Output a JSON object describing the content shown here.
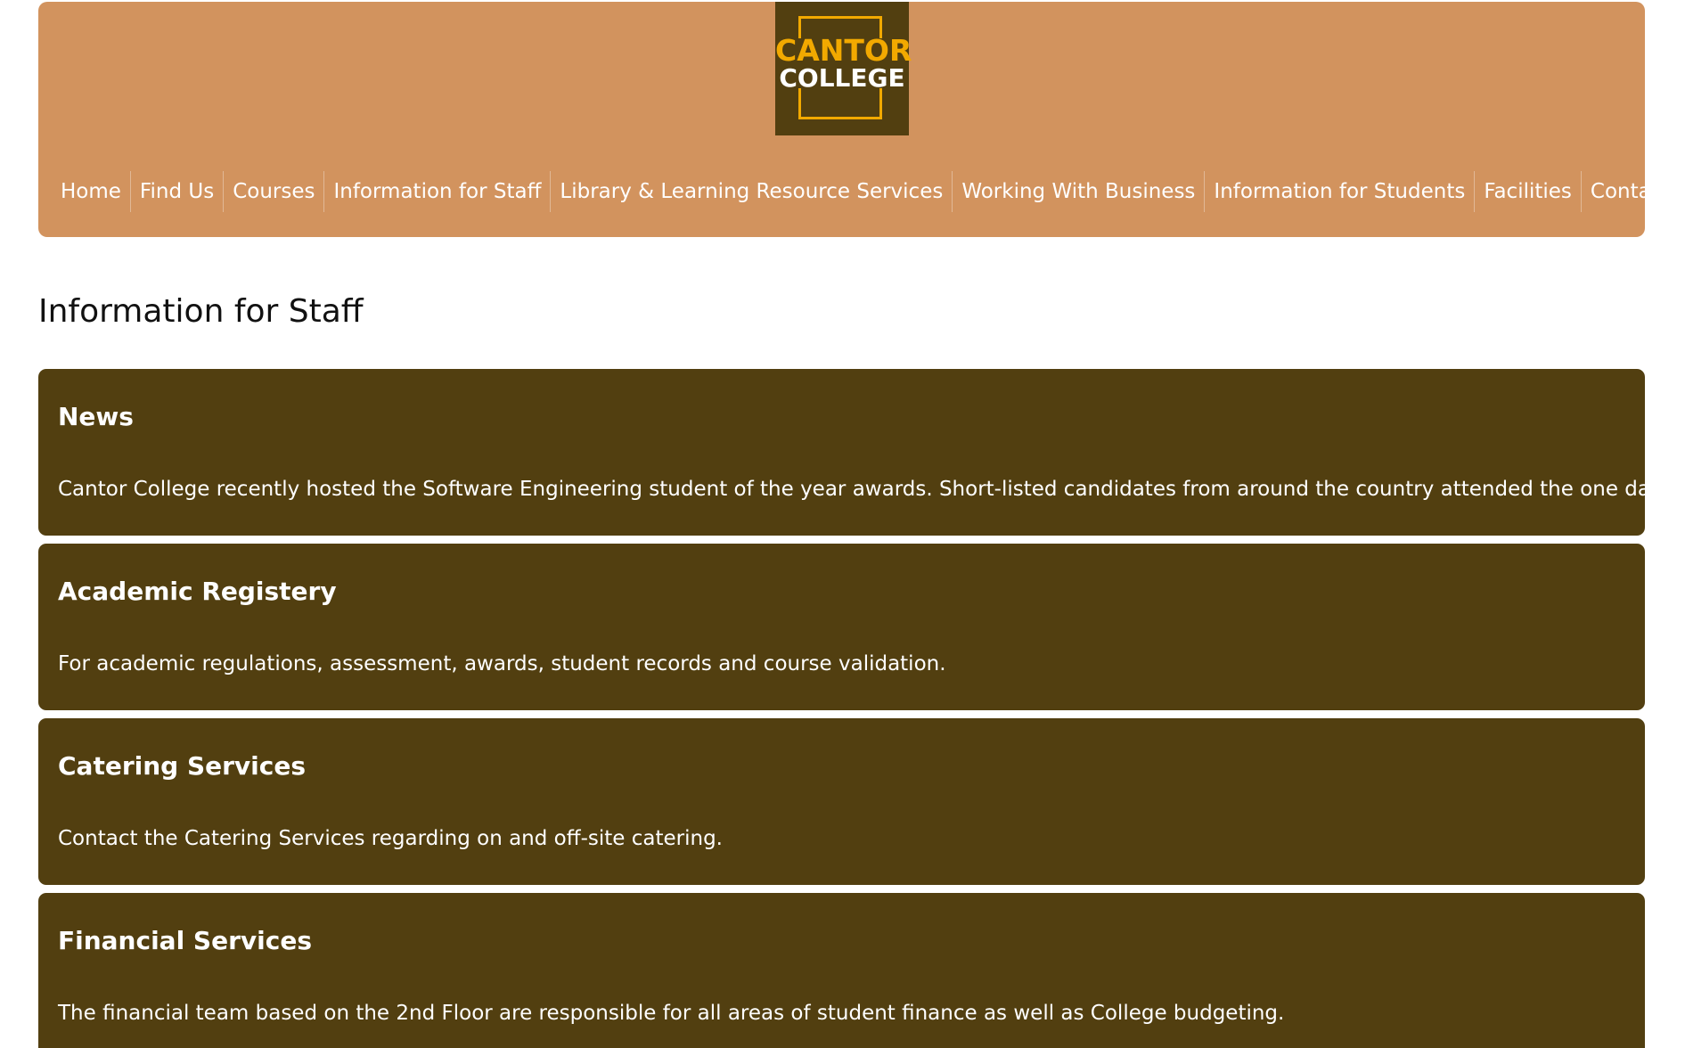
{
  "logo": {
    "line1": "CANTOR",
    "line2": "COLLEGE"
  },
  "nav": {
    "items": [
      "Home",
      "Find Us",
      "Courses",
      "Information for Staff",
      "Library & Learning Resource Services",
      "Working With Business",
      "Information for Students",
      "Facilities",
      "Contact Us"
    ]
  },
  "page_title": "Information for Staff",
  "cards": [
    {
      "title": "News",
      "text": "Cantor College recently hosted the Software Engineering student of the year awards. Short-listed candidates from around the country attended the one day event."
    },
    {
      "title": "Academic Registery",
      "text": "For academic regulations, assessment, awards, student records and course validation."
    },
    {
      "title": "Catering Services",
      "text": "Contact the Catering Services regarding on and off-site catering."
    },
    {
      "title": "Financial Services",
      "text": "The financial team based on the 2nd Floor are responsible for all areas of student finance as well as College budgeting."
    }
  ],
  "colors": {
    "header_bg": "#d2935e",
    "card_bg": "#523f10",
    "logo_accent": "#f2a900",
    "text_light": "#ffffff",
    "text_dark": "#111111"
  }
}
